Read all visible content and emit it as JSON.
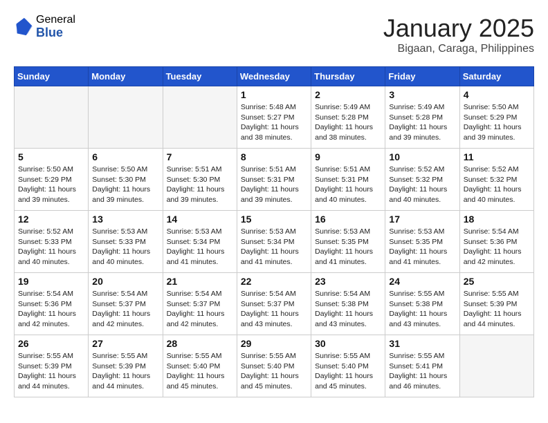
{
  "header": {
    "logo_general": "General",
    "logo_blue": "Blue",
    "month_year": "January 2025",
    "location": "Bigaan, Caraga, Philippines"
  },
  "days_of_week": [
    "Sunday",
    "Monday",
    "Tuesday",
    "Wednesday",
    "Thursday",
    "Friday",
    "Saturday"
  ],
  "weeks": [
    [
      {
        "day": "",
        "empty": true
      },
      {
        "day": "",
        "empty": true
      },
      {
        "day": "",
        "empty": true
      },
      {
        "day": "1",
        "sunrise": "5:48 AM",
        "sunset": "5:27 PM",
        "daylight": "11 hours and 38 minutes."
      },
      {
        "day": "2",
        "sunrise": "5:49 AM",
        "sunset": "5:28 PM",
        "daylight": "11 hours and 38 minutes."
      },
      {
        "day": "3",
        "sunrise": "5:49 AM",
        "sunset": "5:28 PM",
        "daylight": "11 hours and 39 minutes."
      },
      {
        "day": "4",
        "sunrise": "5:50 AM",
        "sunset": "5:29 PM",
        "daylight": "11 hours and 39 minutes."
      }
    ],
    [
      {
        "day": "5",
        "sunrise": "5:50 AM",
        "sunset": "5:29 PM",
        "daylight": "11 hours and 39 minutes."
      },
      {
        "day": "6",
        "sunrise": "5:50 AM",
        "sunset": "5:30 PM",
        "daylight": "11 hours and 39 minutes."
      },
      {
        "day": "7",
        "sunrise": "5:51 AM",
        "sunset": "5:30 PM",
        "daylight": "11 hours and 39 minutes."
      },
      {
        "day": "8",
        "sunrise": "5:51 AM",
        "sunset": "5:31 PM",
        "daylight": "11 hours and 39 minutes."
      },
      {
        "day": "9",
        "sunrise": "5:51 AM",
        "sunset": "5:31 PM",
        "daylight": "11 hours and 40 minutes."
      },
      {
        "day": "10",
        "sunrise": "5:52 AM",
        "sunset": "5:32 PM",
        "daylight": "11 hours and 40 minutes."
      },
      {
        "day": "11",
        "sunrise": "5:52 AM",
        "sunset": "5:32 PM",
        "daylight": "11 hours and 40 minutes."
      }
    ],
    [
      {
        "day": "12",
        "sunrise": "5:52 AM",
        "sunset": "5:33 PM",
        "daylight": "11 hours and 40 minutes."
      },
      {
        "day": "13",
        "sunrise": "5:53 AM",
        "sunset": "5:33 PM",
        "daylight": "11 hours and 40 minutes."
      },
      {
        "day": "14",
        "sunrise": "5:53 AM",
        "sunset": "5:34 PM",
        "daylight": "11 hours and 41 minutes."
      },
      {
        "day": "15",
        "sunrise": "5:53 AM",
        "sunset": "5:34 PM",
        "daylight": "11 hours and 41 minutes."
      },
      {
        "day": "16",
        "sunrise": "5:53 AM",
        "sunset": "5:35 PM",
        "daylight": "11 hours and 41 minutes."
      },
      {
        "day": "17",
        "sunrise": "5:53 AM",
        "sunset": "5:35 PM",
        "daylight": "11 hours and 41 minutes."
      },
      {
        "day": "18",
        "sunrise": "5:54 AM",
        "sunset": "5:36 PM",
        "daylight": "11 hours and 42 minutes."
      }
    ],
    [
      {
        "day": "19",
        "sunrise": "5:54 AM",
        "sunset": "5:36 PM",
        "daylight": "11 hours and 42 minutes."
      },
      {
        "day": "20",
        "sunrise": "5:54 AM",
        "sunset": "5:37 PM",
        "daylight": "11 hours and 42 minutes."
      },
      {
        "day": "21",
        "sunrise": "5:54 AM",
        "sunset": "5:37 PM",
        "daylight": "11 hours and 42 minutes."
      },
      {
        "day": "22",
        "sunrise": "5:54 AM",
        "sunset": "5:37 PM",
        "daylight": "11 hours and 43 minutes."
      },
      {
        "day": "23",
        "sunrise": "5:54 AM",
        "sunset": "5:38 PM",
        "daylight": "11 hours and 43 minutes."
      },
      {
        "day": "24",
        "sunrise": "5:55 AM",
        "sunset": "5:38 PM",
        "daylight": "11 hours and 43 minutes."
      },
      {
        "day": "25",
        "sunrise": "5:55 AM",
        "sunset": "5:39 PM",
        "daylight": "11 hours and 44 minutes."
      }
    ],
    [
      {
        "day": "26",
        "sunrise": "5:55 AM",
        "sunset": "5:39 PM",
        "daylight": "11 hours and 44 minutes."
      },
      {
        "day": "27",
        "sunrise": "5:55 AM",
        "sunset": "5:39 PM",
        "daylight": "11 hours and 44 minutes."
      },
      {
        "day": "28",
        "sunrise": "5:55 AM",
        "sunset": "5:40 PM",
        "daylight": "11 hours and 45 minutes."
      },
      {
        "day": "29",
        "sunrise": "5:55 AM",
        "sunset": "5:40 PM",
        "daylight": "11 hours and 45 minutes."
      },
      {
        "day": "30",
        "sunrise": "5:55 AM",
        "sunset": "5:40 PM",
        "daylight": "11 hours and 45 minutes."
      },
      {
        "day": "31",
        "sunrise": "5:55 AM",
        "sunset": "5:41 PM",
        "daylight": "11 hours and 46 minutes."
      },
      {
        "day": "",
        "empty": true
      }
    ]
  ]
}
